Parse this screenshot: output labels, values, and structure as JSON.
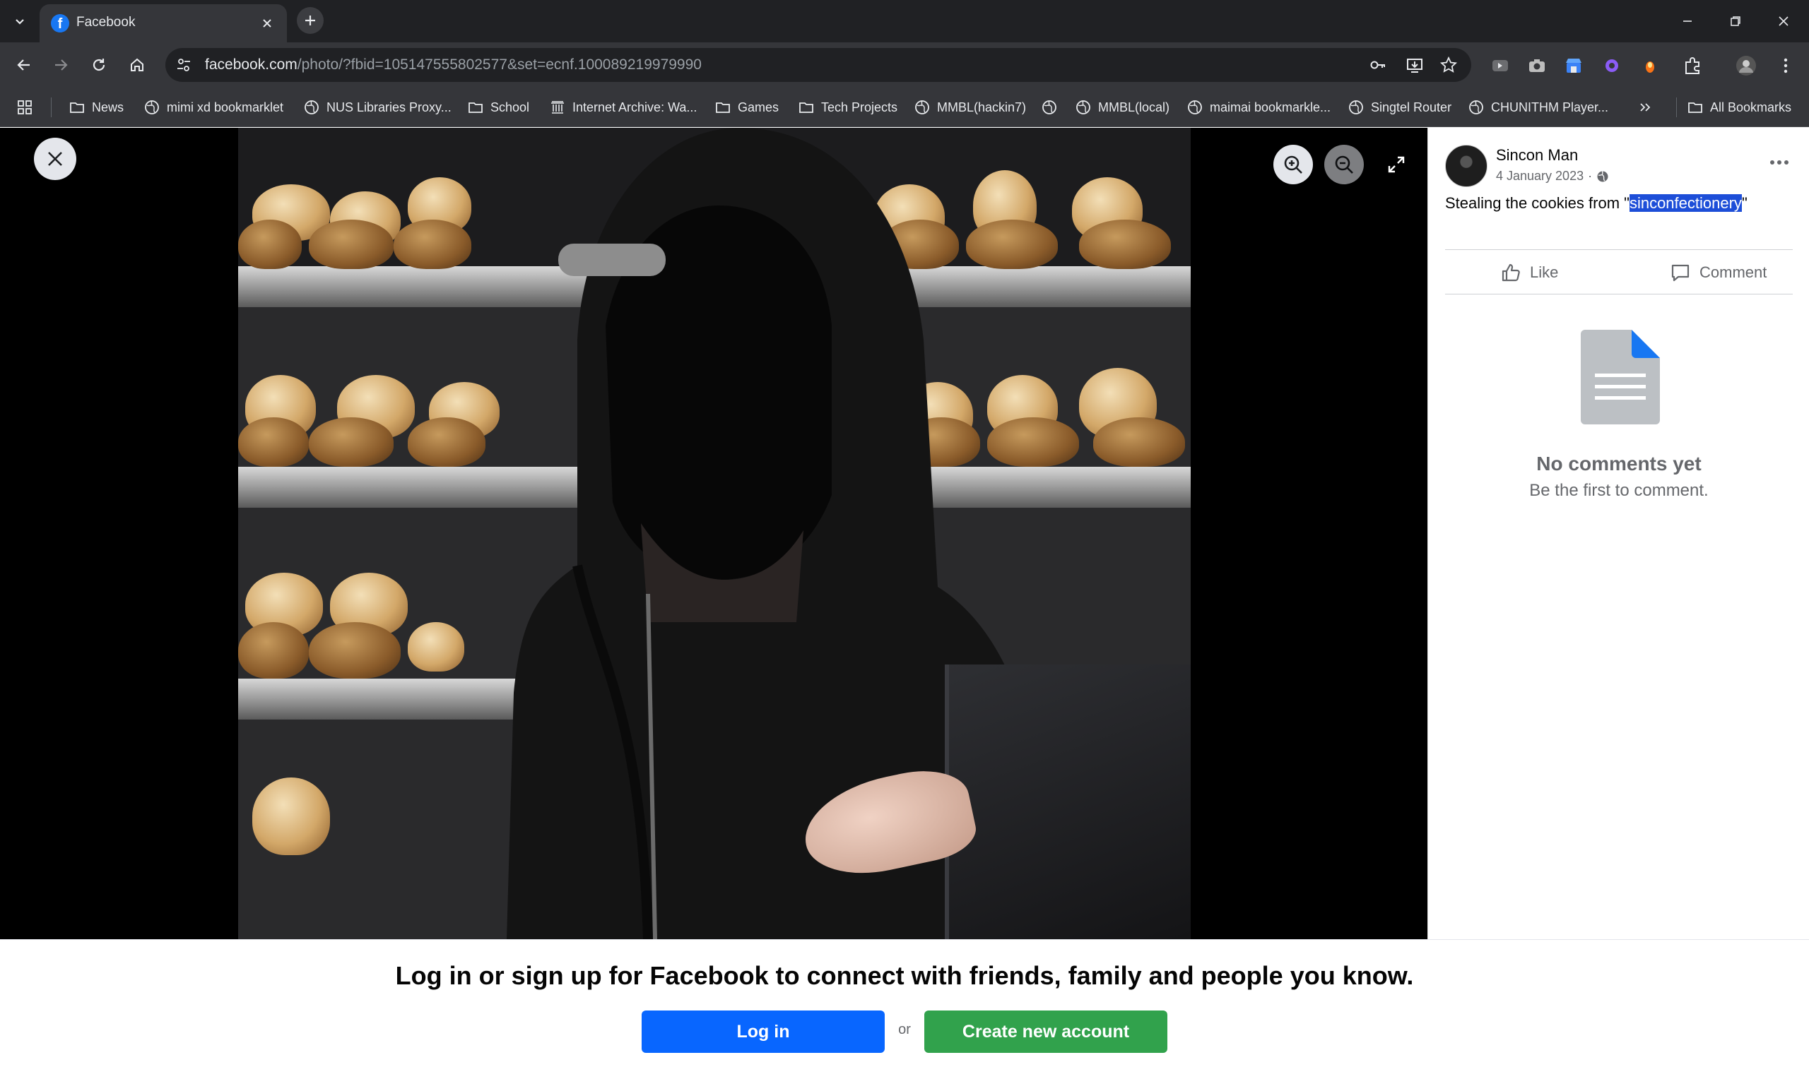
{
  "browser": {
    "tab": {
      "title": "Facebook",
      "favicon": "facebook-icon"
    },
    "url": {
      "host": "facebook.com",
      "path": "/photo/?fbid=105147555802577&set=ecnf.100089219979990"
    },
    "bookmarks": [
      {
        "label": "News",
        "icon": "folder-icon"
      },
      {
        "label": "mimi xd bookmarklet",
        "icon": "globe-icon"
      },
      {
        "label": "NUS Libraries Proxy...",
        "icon": "globe-icon"
      },
      {
        "label": "School",
        "icon": "folder-icon"
      },
      {
        "label": "Internet Archive: Wa...",
        "icon": "archive-icon"
      },
      {
        "label": "Games",
        "icon": "folder-icon"
      },
      {
        "label": "Tech Projects",
        "icon": "folder-icon"
      },
      {
        "label": "MMBL(hackin7)",
        "icon": "globe-icon"
      },
      {
        "label": "",
        "icon": "globe-icon"
      },
      {
        "label": "MMBL(local)",
        "icon": "globe-icon"
      },
      {
        "label": "maimai bookmarkle...",
        "icon": "globe-icon"
      },
      {
        "label": "Singtel Router",
        "icon": "globe-icon"
      },
      {
        "label": "CHUNITHM Player...",
        "icon": "globe-icon"
      }
    ],
    "all_bookmarks": "All Bookmarks"
  },
  "post": {
    "author": "Sincon Man",
    "date": "4 January 2023",
    "privacy_separator": "·",
    "caption_before": "Stealing the cookies from \"",
    "caption_highlight": "sinconfectionery",
    "caption_after": "\"",
    "like_label": "Like",
    "comment_label": "Comment",
    "empty_title": "No comments yet",
    "empty_subtitle": "Be the first to comment."
  },
  "banner": {
    "title": "Log in or sign up for Facebook to connect with friends, family and people you know.",
    "login_label": "Log in",
    "or_label": "or",
    "create_label": "Create new account"
  },
  "colors": {
    "facebook_blue": "#0866ff",
    "create_green": "#31a24c",
    "selection": "#1d4ed8"
  }
}
